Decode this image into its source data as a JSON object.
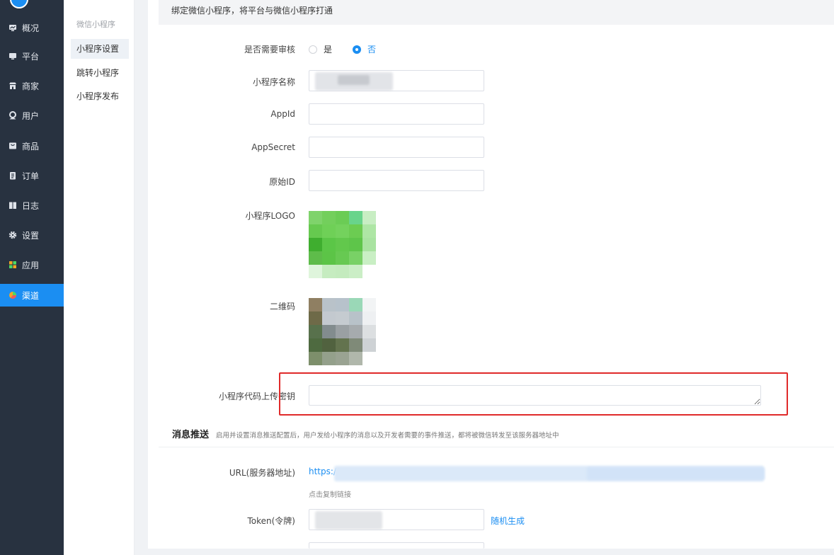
{
  "sidebar": {
    "items": [
      {
        "label": "概况",
        "icon": "overview-icon",
        "active": false
      },
      {
        "label": "平台",
        "icon": "monitor-icon",
        "active": false
      },
      {
        "label": "商家",
        "icon": "store-icon",
        "active": false
      },
      {
        "label": "用户",
        "icon": "user-icon",
        "active": false
      },
      {
        "label": "商品",
        "icon": "goods-icon",
        "active": false
      },
      {
        "label": "订单",
        "icon": "order-icon",
        "active": false
      },
      {
        "label": "日志",
        "icon": "log-icon",
        "active": false
      },
      {
        "label": "设置",
        "icon": "gear-icon",
        "active": false
      },
      {
        "label": "应用",
        "icon": "apps-icon",
        "active": false
      },
      {
        "label": "渠道",
        "icon": "channel-icon",
        "active": true
      }
    ]
  },
  "subnav": {
    "group_title": "微信小程序",
    "items": [
      {
        "label": "小程序设置",
        "active": true
      },
      {
        "label": "跳转小程序",
        "active": false
      },
      {
        "label": "小程序发布",
        "active": false
      }
    ]
  },
  "notice": "绑定微信小程序，将平台与微信小程序打通",
  "form": {
    "review_label": "是否需要审核",
    "review_yes": "是",
    "review_no": "否",
    "review_value": "否",
    "name_label": "小程序名称",
    "appid_label": "AppId",
    "appsecret_label": "AppSecret",
    "original_id_label": "原始ID",
    "logo_label": "小程序LOGO",
    "qrcode_label": "二维码",
    "upload_key_label": "小程序代码上传密钥"
  },
  "message_push": {
    "title": "消息推送",
    "desc": "启用并设置消息推送配置后，用户发给小程序的消息以及开发者需要的事件推送，都将被微信转发至该服务器地址中",
    "url_label": "URL(服务器地址)",
    "url_value": "https://",
    "copy_hint": "点击复制链接",
    "token_label": "Token(令牌)",
    "random_label": "随机生成"
  },
  "colors": {
    "sidebar_bg": "#283240",
    "accent": "#1b8ef2",
    "highlight": "#e02a2a"
  }
}
